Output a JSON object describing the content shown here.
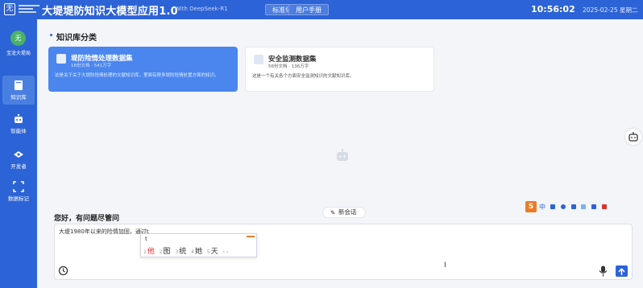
{
  "header": {
    "logo_glyph": "无",
    "title": "大堤堤防知识大模型应用1.0",
    "subtitle": "With DeepSeek-R1",
    "nav": [
      "标准化平台",
      "用户手册"
    ],
    "time": "10:56:02",
    "date": "2025-02-25 星期二"
  },
  "sidebar": {
    "avatar_text": "无",
    "user_name": "宝淦大堤局",
    "items": [
      {
        "label": "知识库",
        "icon": "book-icon",
        "active": true
      },
      {
        "label": "智能体",
        "icon": "robot-icon",
        "active": false
      },
      {
        "label": "开发者",
        "icon": "code-icon",
        "active": false
      },
      {
        "label": "数据标记",
        "icon": "scan-icon",
        "active": false
      }
    ]
  },
  "main": {
    "section_title": "知识库分类",
    "cards": [
      {
        "name": "堤防险情处理数据集",
        "meta": "16份文档 · 541万字",
        "desc": "这是关于关于大堤防险情处理的文献知识库，里面有很多堤防险情处置方面的知识。"
      },
      {
        "name": "安全监测数据集",
        "meta": "56份文档 · 136万字",
        "desc": "这是一个有关各个方面安全监测知识的文献知识库。"
      }
    ],
    "new_chat_label": "新会话",
    "greeting": "您好，有问题尽管问",
    "input_text": "大堤1980年以来的险情加固，通过t",
    "ime": {
      "preedit": "t",
      "candidates": [
        "他",
        "图",
        "统",
        "她",
        "天"
      ],
      "toolbar_zh": "中"
    }
  },
  "colors": {
    "primary": "#2c63d6",
    "card_active": "#4a86ee",
    "sogou_orange": "#f07a22"
  }
}
